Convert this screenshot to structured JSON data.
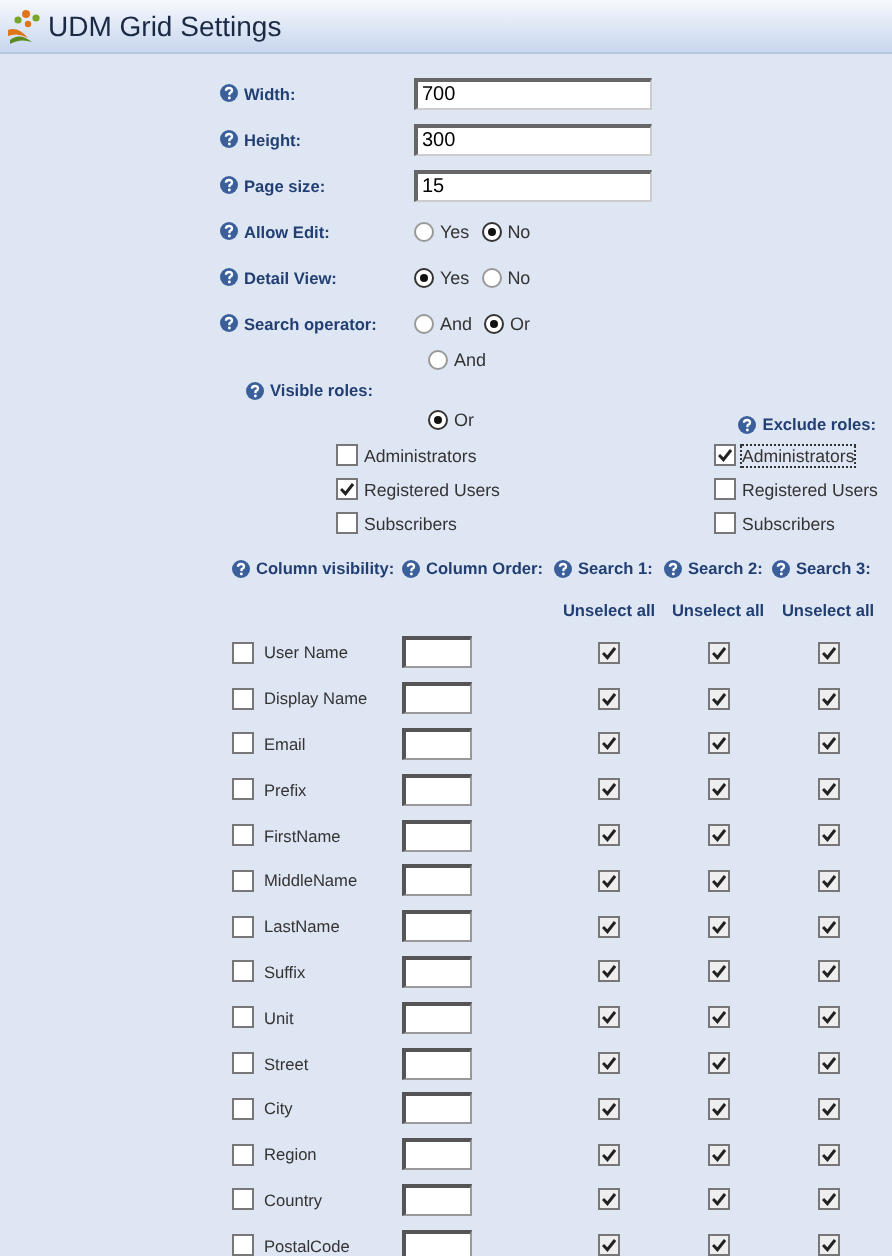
{
  "title": "UDM Grid Settings",
  "fields": [
    {
      "kind": "text",
      "label": "Width:",
      "value": "700"
    },
    {
      "kind": "text",
      "label": "Height:",
      "value": "300"
    },
    {
      "kind": "text",
      "label": "Page size:",
      "value": "15"
    },
    {
      "kind": "radio",
      "label": "Allow Edit:",
      "options": [
        {
          "label": "Yes",
          "selected": false
        },
        {
          "label": "No",
          "selected": true
        }
      ]
    },
    {
      "kind": "radio",
      "label": "Detail View:",
      "options": [
        {
          "label": "Yes",
          "selected": true
        },
        {
          "label": "No",
          "selected": false
        }
      ]
    },
    {
      "kind": "radio",
      "label": "Search operator:",
      "options": [
        {
          "label": "And",
          "selected": false
        },
        {
          "label": "Or",
          "selected": true
        }
      ]
    }
  ],
  "visible_roles": {
    "label": "Visible roles:",
    "options": [
      {
        "label": "And",
        "selected": false
      },
      {
        "label": "Or",
        "selected": true
      }
    ],
    "roles": [
      {
        "label": "Administrators",
        "checked": false
      },
      {
        "label": "Registered Users",
        "checked": true
      },
      {
        "label": "Subscribers",
        "checked": false
      }
    ]
  },
  "exclude_roles": {
    "label": "Exclude roles:",
    "roles": [
      {
        "label": "Administrators",
        "checked": true
      },
      {
        "label": "Registered Users",
        "checked": false
      },
      {
        "label": "Subscribers",
        "checked": false
      }
    ]
  },
  "columns_table": {
    "headers": [
      "Column visibility:",
      "Column Order:",
      "Search 1:",
      "Search 2:",
      "Search 3:"
    ],
    "unselect_links": [
      "Unselect all",
      "Unselect all",
      "Unselect all"
    ],
    "rows": [
      {
        "name": "User Name",
        "visible": false,
        "search": [
          true,
          true,
          true
        ]
      },
      {
        "name": "Display Name",
        "visible": false,
        "search": [
          true,
          true,
          true
        ]
      },
      {
        "name": "Email",
        "visible": false,
        "search": [
          true,
          true,
          true
        ]
      },
      {
        "name": "Prefix",
        "visible": false,
        "search": [
          true,
          true,
          true
        ]
      },
      {
        "name": "FirstName",
        "visible": false,
        "search": [
          true,
          true,
          true
        ]
      },
      {
        "name": "MiddleName",
        "visible": false,
        "search": [
          true,
          true,
          true
        ]
      },
      {
        "name": "LastName",
        "visible": false,
        "search": [
          true,
          true,
          true
        ]
      },
      {
        "name": "Suffix",
        "visible": false,
        "search": [
          true,
          true,
          true
        ]
      },
      {
        "name": "Unit",
        "visible": false,
        "search": [
          true,
          true,
          true
        ]
      },
      {
        "name": "Street",
        "visible": false,
        "search": [
          true,
          true,
          true
        ]
      },
      {
        "name": "City",
        "visible": false,
        "search": [
          true,
          true,
          true
        ]
      },
      {
        "name": "Region",
        "visible": false,
        "search": [
          true,
          true,
          true
        ]
      },
      {
        "name": "Country",
        "visible": false,
        "search": [
          true,
          true,
          true
        ]
      },
      {
        "name": "PostalCode",
        "visible": false,
        "search": [
          true,
          true,
          true
        ]
      }
    ]
  }
}
